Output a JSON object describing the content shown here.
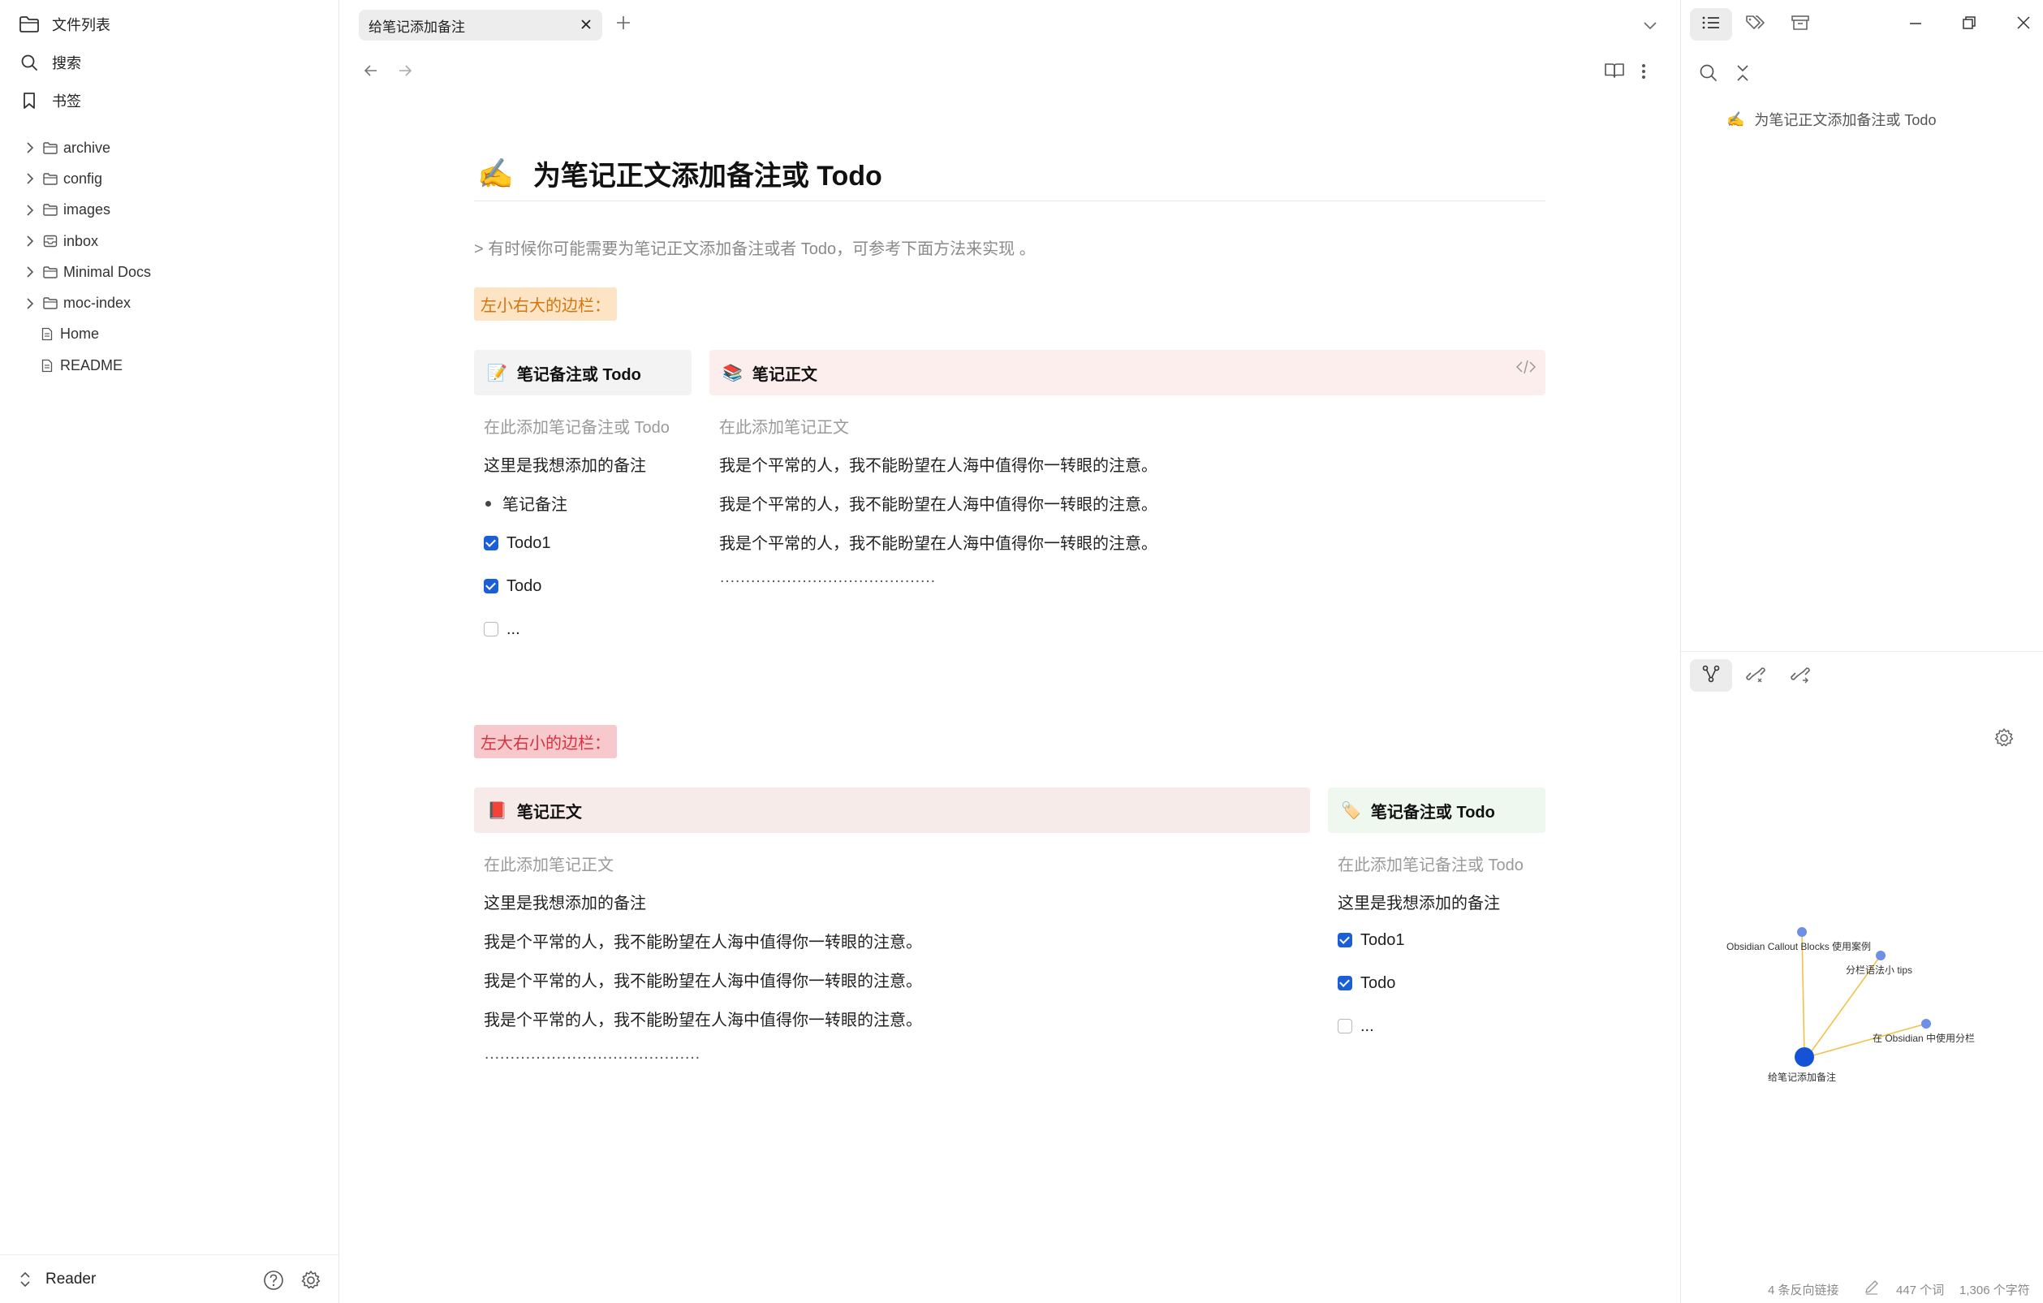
{
  "left_sidebar": {
    "file_list_label": "文件列表",
    "search_label": "搜索",
    "bookmarks_label": "书签",
    "tree": [
      {
        "label": "archive",
        "type": "folder"
      },
      {
        "label": "config",
        "type": "folder"
      },
      {
        "label": "images",
        "type": "folder"
      },
      {
        "label": "inbox",
        "type": "folder-special"
      },
      {
        "label": "Minimal Docs",
        "type": "folder"
      },
      {
        "label": "moc-index",
        "type": "folder"
      },
      {
        "label": "Home",
        "type": "file"
      },
      {
        "label": "README",
        "type": "file"
      }
    ],
    "vault_name": "Reader"
  },
  "tabs": [
    {
      "label": "给笔记添加备注",
      "active": true
    }
  ],
  "note": {
    "title_emoji": "✍️",
    "title": "为笔记正文添加备注或 Todo",
    "quote": "> 有时候你可能需要为笔记正文添加备注或者 Todo，可参考下面方法来实现 。",
    "section1_label": "左小右大的边栏：",
    "section2_label": "左大右小的边栏：",
    "s1_left": {
      "emoji": "📝",
      "heading": "笔记备注或 Todo",
      "placeholder": "在此添加笔记备注或 Todo",
      "line1": "这里是我想添加的备注",
      "bullet": "笔记备注",
      "todo1": "Todo1",
      "todo2": "Todo",
      "todo3": "..."
    },
    "s1_right": {
      "emoji": "📚",
      "heading": "笔记正文",
      "placeholder": "在此添加笔记正文",
      "lines": [
        "我是个平常的人，我不能盼望在人海中值得你一转眼的注意。",
        "我是个平常的人，我不能盼望在人海中值得你一转眼的注意。",
        "我是个平常的人，我不能盼望在人海中值得你一转眼的注意。"
      ],
      "dots": "……………………………………"
    },
    "s2_left": {
      "emoji": "📕",
      "heading": "笔记正文",
      "placeholder": "在此添加笔记正文",
      "line1": "这里是我想添加的备注",
      "lines": [
        "我是个平常的人，我不能盼望在人海中值得你一转眼的注意。",
        "我是个平常的人，我不能盼望在人海中值得你一转眼的注意。",
        "我是个平常的人，我不能盼望在人海中值得你一转眼的注意。"
      ],
      "dots": "……………………………………"
    },
    "s2_right": {
      "emoji": "🏷️",
      "heading": "笔记备注或 Todo",
      "placeholder": "在此添加笔记备注或 Todo",
      "line1": "这里是我想添加的备注",
      "todo1": "Todo1",
      "todo2": "Todo",
      "todo3": "..."
    }
  },
  "right_sidebar": {
    "outline": [
      {
        "emoji": "✍️",
        "label": "为笔记正文添加备注或 Todo"
      }
    ],
    "graph_nodes": [
      {
        "label": "Obsidian Callout Blocks 使用案例"
      },
      {
        "label": "分栏语法小 tips"
      },
      {
        "label": "在 Obsidian 中使用分栏"
      },
      {
        "label": "给笔记添加备注"
      }
    ],
    "status": {
      "backlinks": "4 条反向链接",
      "words": "447 个词",
      "chars": "1,306 个字符"
    }
  },
  "colors": {
    "accent": "#1a5fd6",
    "orange_highlight_bg": "#fde4c5",
    "orange_highlight_text": "#d4750e",
    "red_highlight_bg": "#f7c9cd",
    "red_highlight_text": "#d6333f",
    "callout_grey": "#f3f3f3",
    "callout_pink": "#fdeeee",
    "callout_rose": "#f7ebea",
    "callout_green": "#eef8ef",
    "graph_edge": "#f0c24a",
    "graph_node": "#6d8fe8",
    "graph_active_node": "#1553d6"
  }
}
